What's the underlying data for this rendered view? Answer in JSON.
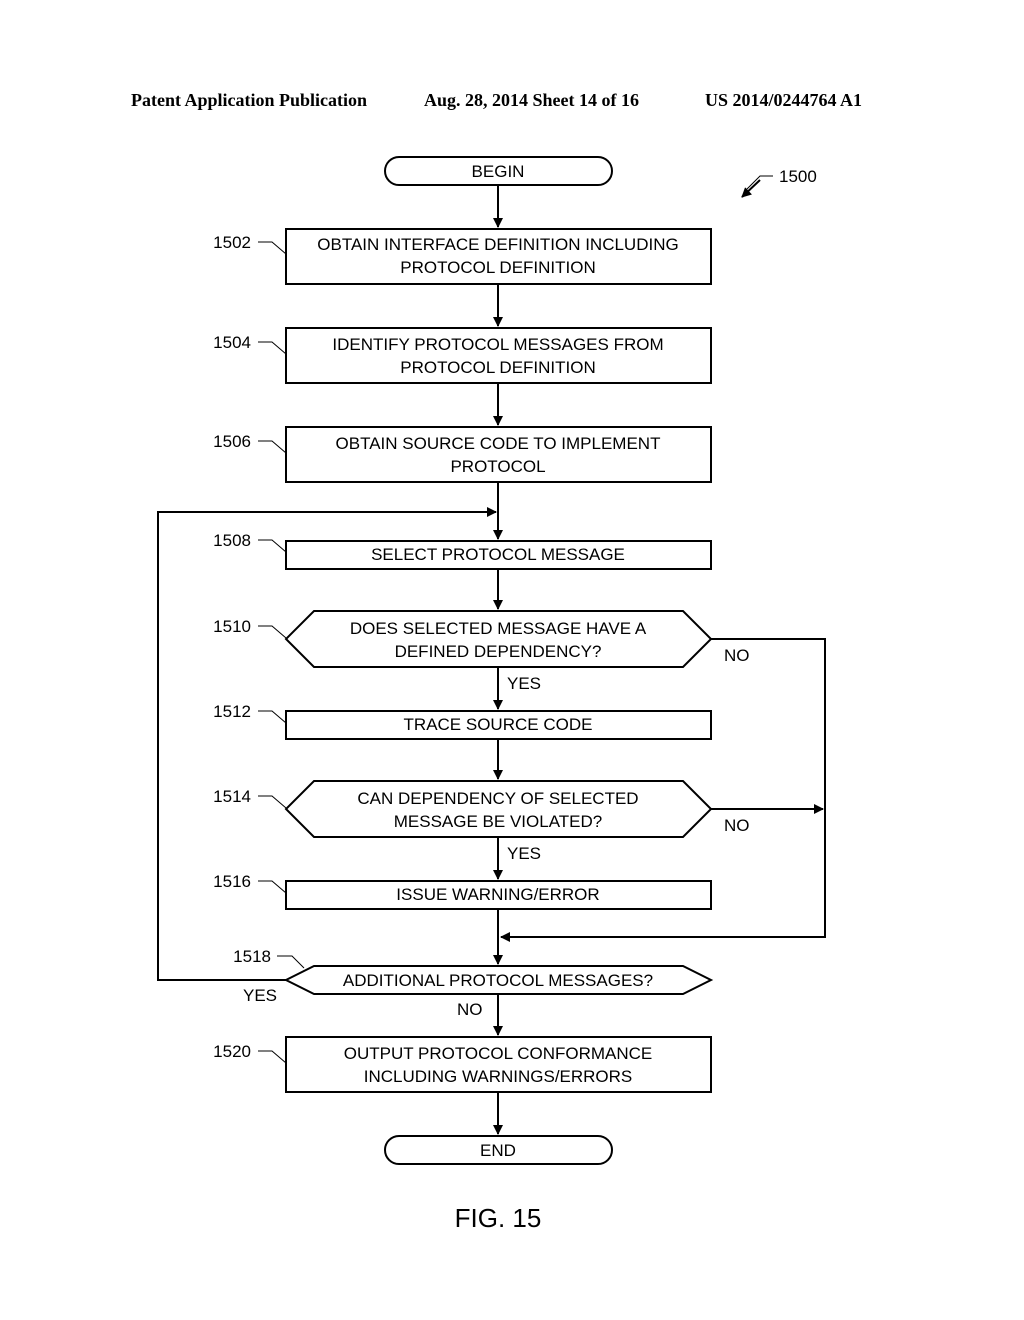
{
  "header": {
    "publication": "Patent Application Publication",
    "date_sheet": "Aug. 28, 2014  Sheet 14 of 16",
    "number": "US 2014/0244764 A1"
  },
  "figure": {
    "ref": "1500",
    "caption": "FIG. 15"
  },
  "nodes": {
    "begin": {
      "text": "BEGIN"
    },
    "n1502": {
      "ref": "1502",
      "lines": [
        "OBTAIN INTERFACE DEFINITION INCLUDING",
        "PROTOCOL DEFINITION"
      ]
    },
    "n1504": {
      "ref": "1504",
      "lines": [
        "IDENTIFY PROTOCOL MESSAGES FROM",
        "PROTOCOL DEFINITION"
      ]
    },
    "n1506": {
      "ref": "1506",
      "lines": [
        "OBTAIN SOURCE CODE TO IMPLEMENT",
        "PROTOCOL"
      ]
    },
    "n1508": {
      "ref": "1508",
      "lines": [
        "SELECT PROTOCOL MESSAGE"
      ]
    },
    "n1510": {
      "ref": "1510",
      "lines": [
        "DOES SELECTED MESSAGE HAVE A",
        "DEFINED DEPENDENCY?"
      ],
      "yes": "YES",
      "no": "NO"
    },
    "n1512": {
      "ref": "1512",
      "lines": [
        "TRACE SOURCE CODE"
      ]
    },
    "n1514": {
      "ref": "1514",
      "lines": [
        "CAN DEPENDENCY OF SELECTED",
        "MESSAGE BE VIOLATED?"
      ],
      "yes": "YES",
      "no": "NO"
    },
    "n1516": {
      "ref": "1516",
      "lines": [
        "ISSUE WARNING/ERROR"
      ]
    },
    "n1518": {
      "ref": "1518",
      "lines": [
        "ADDITIONAL PROTOCOL MESSAGES?"
      ],
      "yes": "YES",
      "no": "NO"
    },
    "n1520": {
      "ref": "1520",
      "lines": [
        "OUTPUT PROTOCOL CONFORMANCE",
        "INCLUDING WARNINGS/ERRORS"
      ]
    },
    "end": {
      "text": "END"
    }
  }
}
